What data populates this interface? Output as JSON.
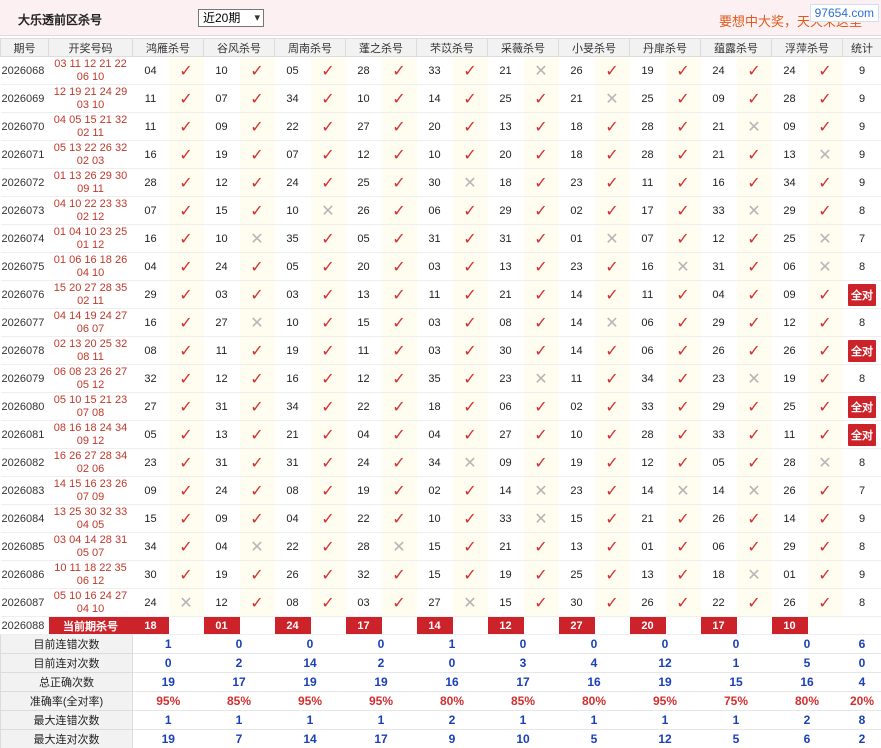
{
  "header": {
    "title": "大乐透前区杀号",
    "range_selected": "近20期",
    "slogan": "要想中大奖，天天来这里",
    "watermark": "97654.com"
  },
  "columns": {
    "period": "期号",
    "draw": "开奖号码",
    "experts": [
      "鸿雁杀号",
      "谷风杀号",
      "周南杀号",
      "蓬之杀号",
      "芣苡杀号",
      "采薇杀号",
      "小旻杀号",
      "丹扉杀号",
      "蕴露杀号",
      "浮萍杀号"
    ],
    "stat": "统计"
  },
  "rows": [
    {
      "period": "2026068",
      "draw1": "03 11 12 21 22",
      "draw2": "06 10",
      "kills": [
        "04",
        "10",
        "05",
        "28",
        "33",
        "21",
        "26",
        "19",
        "24",
        "24"
      ],
      "hits": [
        1,
        1,
        1,
        1,
        1,
        0,
        1,
        1,
        1,
        1
      ],
      "stat": "9"
    },
    {
      "period": "2026069",
      "draw1": "12 19 21 24 29",
      "draw2": "03 10",
      "kills": [
        "11",
        "07",
        "34",
        "10",
        "14",
        "25",
        "21",
        "25",
        "09",
        "28"
      ],
      "hits": [
        1,
        1,
        1,
        1,
        1,
        1,
        0,
        1,
        1,
        1
      ],
      "stat": "9"
    },
    {
      "period": "2026070",
      "draw1": "04 05 15 21 32",
      "draw2": "02 11",
      "kills": [
        "11",
        "09",
        "22",
        "27",
        "20",
        "13",
        "18",
        "28",
        "21",
        "09"
      ],
      "hits": [
        1,
        1,
        1,
        1,
        1,
        1,
        1,
        1,
        0,
        1
      ],
      "stat": "9"
    },
    {
      "period": "2026071",
      "draw1": "05 13 22 26 32",
      "draw2": "02 03",
      "kills": [
        "16",
        "19",
        "07",
        "12",
        "10",
        "20",
        "18",
        "28",
        "21",
        "13"
      ],
      "hits": [
        1,
        1,
        1,
        1,
        1,
        1,
        1,
        1,
        1,
        0
      ],
      "stat": "9"
    },
    {
      "period": "2026072",
      "draw1": "01 13 26 29 30",
      "draw2": "09 11",
      "kills": [
        "28",
        "12",
        "24",
        "25",
        "30",
        "18",
        "23",
        "11",
        "16",
        "34"
      ],
      "hits": [
        1,
        1,
        1,
        1,
        0,
        1,
        1,
        1,
        1,
        1
      ],
      "stat": "9"
    },
    {
      "period": "2026073",
      "draw1": "04 10 22 23 33",
      "draw2": "02 12",
      "kills": [
        "07",
        "15",
        "10",
        "26",
        "06",
        "29",
        "02",
        "17",
        "33",
        "29"
      ],
      "hits": [
        1,
        1,
        0,
        1,
        1,
        1,
        1,
        1,
        0,
        1
      ],
      "stat": "8"
    },
    {
      "period": "2026074",
      "draw1": "01 04 10 23 25",
      "draw2": "01 12",
      "kills": [
        "16",
        "10",
        "35",
        "05",
        "31",
        "31",
        "01",
        "07",
        "12",
        "25"
      ],
      "hits": [
        1,
        0,
        1,
        1,
        1,
        1,
        0,
        1,
        1,
        0
      ],
      "stat": "7"
    },
    {
      "period": "2026075",
      "draw1": "01 06 16 18 26",
      "draw2": "04 10",
      "kills": [
        "04",
        "24",
        "05",
        "20",
        "03",
        "13",
        "23",
        "16",
        "31",
        "06"
      ],
      "hits": [
        1,
        1,
        1,
        1,
        1,
        1,
        1,
        0,
        1,
        0
      ],
      "stat": "8"
    },
    {
      "period": "2026076",
      "draw1": "15 20 27 28 35",
      "draw2": "02 11",
      "kills": [
        "29",
        "03",
        "03",
        "13",
        "11",
        "21",
        "14",
        "11",
        "04",
        "09"
      ],
      "hits": [
        1,
        1,
        1,
        1,
        1,
        1,
        1,
        1,
        1,
        1
      ],
      "stat": "全对"
    },
    {
      "period": "2026077",
      "draw1": "04 14 19 24 27",
      "draw2": "06 07",
      "kills": [
        "16",
        "27",
        "10",
        "15",
        "03",
        "08",
        "14",
        "06",
        "29",
        "12"
      ],
      "hits": [
        1,
        0,
        1,
        1,
        1,
        1,
        0,
        1,
        1,
        1
      ],
      "stat": "8"
    },
    {
      "period": "2026078",
      "draw1": "02 13 20 25 32",
      "draw2": "08 11",
      "kills": [
        "08",
        "11",
        "19",
        "11",
        "03",
        "30",
        "14",
        "06",
        "26",
        "26"
      ],
      "hits": [
        1,
        1,
        1,
        1,
        1,
        1,
        1,
        1,
        1,
        1
      ],
      "stat": "全对"
    },
    {
      "period": "2026079",
      "draw1": "06 08 23 26 27",
      "draw2": "05 12",
      "kills": [
        "32",
        "12",
        "16",
        "12",
        "35",
        "23",
        "11",
        "34",
        "23",
        "19"
      ],
      "hits": [
        1,
        1,
        1,
        1,
        1,
        0,
        1,
        1,
        0,
        1
      ],
      "stat": "8"
    },
    {
      "period": "2026080",
      "draw1": "05 10 15 21 23",
      "draw2": "07 08",
      "kills": [
        "27",
        "31",
        "34",
        "22",
        "18",
        "06",
        "02",
        "33",
        "29",
        "25"
      ],
      "hits": [
        1,
        1,
        1,
        1,
        1,
        1,
        1,
        1,
        1,
        1
      ],
      "stat": "全对"
    },
    {
      "period": "2026081",
      "draw1": "08 16 18 24 34",
      "draw2": "09 12",
      "kills": [
        "05",
        "13",
        "21",
        "04",
        "04",
        "27",
        "10",
        "28",
        "33",
        "11"
      ],
      "hits": [
        1,
        1,
        1,
        1,
        1,
        1,
        1,
        1,
        1,
        1
      ],
      "stat": "全对"
    },
    {
      "period": "2026082",
      "draw1": "16 26 27 28 34",
      "draw2": "02 06",
      "kills": [
        "23",
        "31",
        "31",
        "24",
        "34",
        "09",
        "19",
        "12",
        "05",
        "28"
      ],
      "hits": [
        1,
        1,
        1,
        1,
        0,
        1,
        1,
        1,
        1,
        0
      ],
      "stat": "8"
    },
    {
      "period": "2026083",
      "draw1": "14 15 16 23 26",
      "draw2": "07 09",
      "kills": [
        "09",
        "24",
        "08",
        "19",
        "02",
        "14",
        "23",
        "14",
        "14",
        "26"
      ],
      "hits": [
        1,
        1,
        1,
        1,
        1,
        0,
        1,
        0,
        0,
        1
      ],
      "stat": "7"
    },
    {
      "period": "2026084",
      "draw1": "13 25 30 32 33",
      "draw2": "04 05",
      "kills": [
        "15",
        "09",
        "04",
        "22",
        "10",
        "33",
        "15",
        "21",
        "26",
        "14"
      ],
      "hits": [
        1,
        1,
        1,
        1,
        1,
        0,
        1,
        1,
        1,
        1
      ],
      "stat": "9"
    },
    {
      "period": "2026085",
      "draw1": "03 04 14 28 31",
      "draw2": "05 07",
      "kills": [
        "34",
        "04",
        "22",
        "28",
        "15",
        "21",
        "13",
        "01",
        "06",
        "29"
      ],
      "hits": [
        1,
        0,
        1,
        0,
        1,
        1,
        1,
        1,
        1,
        1
      ],
      "stat": "8"
    },
    {
      "period": "2026086",
      "draw1": "10 11 18 22 35",
      "draw2": "06 12",
      "kills": [
        "30",
        "19",
        "26",
        "32",
        "15",
        "19",
        "25",
        "13",
        "18",
        "01"
      ],
      "hits": [
        1,
        1,
        1,
        1,
        1,
        1,
        1,
        1,
        0,
        1
      ],
      "stat": "9"
    },
    {
      "period": "2026087",
      "draw1": "05 10 16 24 27",
      "draw2": "04 10",
      "kills": [
        "24",
        "12",
        "08",
        "03",
        "27",
        "15",
        "30",
        "26",
        "22",
        "26"
      ],
      "hits": [
        0,
        1,
        1,
        1,
        0,
        1,
        1,
        1,
        1,
        1
      ],
      "stat": "8"
    }
  ],
  "current": {
    "period": "2026088",
    "label": "当前期杀号",
    "kills": [
      "18",
      "01",
      "24",
      "17",
      "14",
      "12",
      "27",
      "20",
      "17",
      "10"
    ]
  },
  "summary": [
    {
      "label": "目前连错次数",
      "values": [
        "1",
        "0",
        "0",
        "0",
        "1",
        "0",
        "0",
        "0",
        "0",
        "0",
        "6"
      ],
      "rate": false
    },
    {
      "label": "目前连对次数",
      "values": [
        "0",
        "2",
        "14",
        "2",
        "0",
        "3",
        "4",
        "12",
        "1",
        "5",
        "0"
      ],
      "rate": false
    },
    {
      "label": "总正确次数",
      "values": [
        "19",
        "17",
        "19",
        "19",
        "16",
        "17",
        "16",
        "19",
        "15",
        "16",
        "4"
      ],
      "rate": false
    },
    {
      "label": "准确率(全对率)",
      "values": [
        "95%",
        "85%",
        "95%",
        "95%",
        "80%",
        "85%",
        "80%",
        "95%",
        "75%",
        "80%",
        "20%"
      ],
      "rate": true
    },
    {
      "label": "最大连错次数",
      "values": [
        "1",
        "1",
        "1",
        "1",
        "2",
        "1",
        "1",
        "1",
        "1",
        "2",
        "8"
      ],
      "rate": false
    },
    {
      "label": "最大连对次数",
      "values": [
        "19",
        "7",
        "14",
        "17",
        "9",
        "10",
        "5",
        "12",
        "5",
        "6",
        "2"
      ],
      "rate": false
    }
  ],
  "marks": {
    "hit": "✓",
    "miss": "✕"
  }
}
